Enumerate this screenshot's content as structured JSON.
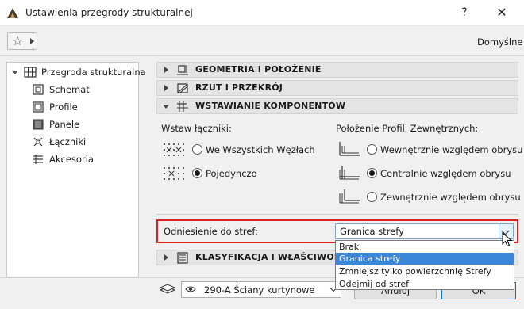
{
  "window": {
    "title": "Ustawienia przegrody strukturalnej",
    "help": "?",
    "close": "✕"
  },
  "toolbar": {
    "favorites_icon": "star-icon",
    "defaults_label": "Domyślne"
  },
  "tree": {
    "root": "Przegroda strukturalna",
    "items": [
      "Schemat",
      "Profile",
      "Panele",
      "Łączniki",
      "Akcesoria"
    ]
  },
  "sections": {
    "geometry": "GEOMETRIA I POŁOŻENIE",
    "plan": "RZUT I PRZEKRÓJ",
    "components": "WSTAWIANIE KOMPONENTÓW",
    "classification": "KLASYFIKACJA I WŁAŚCIWOŚCI"
  },
  "connectors": {
    "label": "Wstaw łączniki:",
    "options": [
      "We Wszystkich Węzłach",
      "Pojedynczo"
    ],
    "selected": 1
  },
  "profiles": {
    "label": "Położenie Profili Zewnętrznych:",
    "options": [
      "Wewnętrznie względem obrysu",
      "Centralnie względem obrysu",
      "Zewnętrznie względem obrysu"
    ],
    "selected": 1
  },
  "zone_reference": {
    "label": "Odniesienie do stref:",
    "value": "Granica strefy",
    "options": [
      "Brak",
      "Granica strefy",
      "Zmniejsz tylko powierzchnię Strefy",
      "Odejmij od stref"
    ],
    "highlight_color": "#e02020",
    "selection_color": "#3a86d8"
  },
  "footer": {
    "layer": "290-A Ściany kurtynowe",
    "cancel": "Anuluj",
    "ok": "OK"
  }
}
